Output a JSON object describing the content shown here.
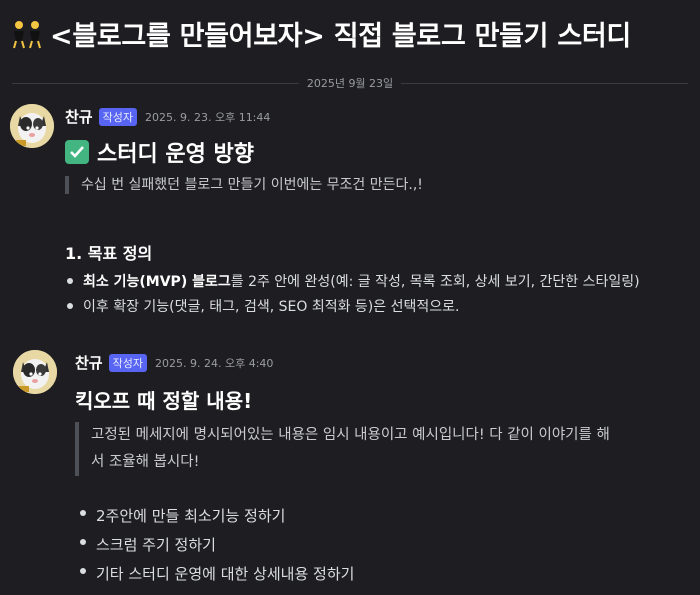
{
  "channel": {
    "emoji_icon": "dancing-people-emoji",
    "title": "<블로그를 만들어보자> 직접 블로그 만들기 스터디"
  },
  "date_divider": "2025년 9월 23일",
  "messages": [
    {
      "author": "찬규",
      "badge": "작성자",
      "timestamp": "2025. 9. 23. 오후 11:44",
      "heading_icon": "check-mark-button-emoji",
      "heading": "스터디 운영 방향",
      "quote": "수십 번 실패했던 블로그 만들기 이번에는 무조건 만든다.,!",
      "subheading": "1. 목표 정의",
      "bullets": [
        {
          "bold": "최소 기능(MVP) 블로그",
          "text": "를 2주 안에 완성(예: 글 작성, 목록 조회, 상세 보기, 간단한 스타일링)"
        },
        {
          "bold": "",
          "text": "이후 확장 기능(댓글, 태그, 검색, SEO 최적화 등)은 선택적으로."
        }
      ]
    },
    {
      "author": "찬규",
      "badge": "작성자",
      "timestamp": "2025. 9. 24. 오후 4:40",
      "heading": "킥오프 때 정할 내용!",
      "quote_line1": "고정된 메세지에 명시되어있는 내용은 임시 내용이고 예시입니다! 다 같이 이야기를 해",
      "quote_line2": "서 조율해 봅시다!",
      "bullets": [
        "2주안에 만들 최소기능 정하기",
        "스크럼 주기 정하기",
        "기타 스터디 운영에 대한 상세내용 정하기"
      ]
    }
  ],
  "colors": {
    "background": "#1e1e22",
    "badge": "#5865f2",
    "check": "#43b581"
  }
}
